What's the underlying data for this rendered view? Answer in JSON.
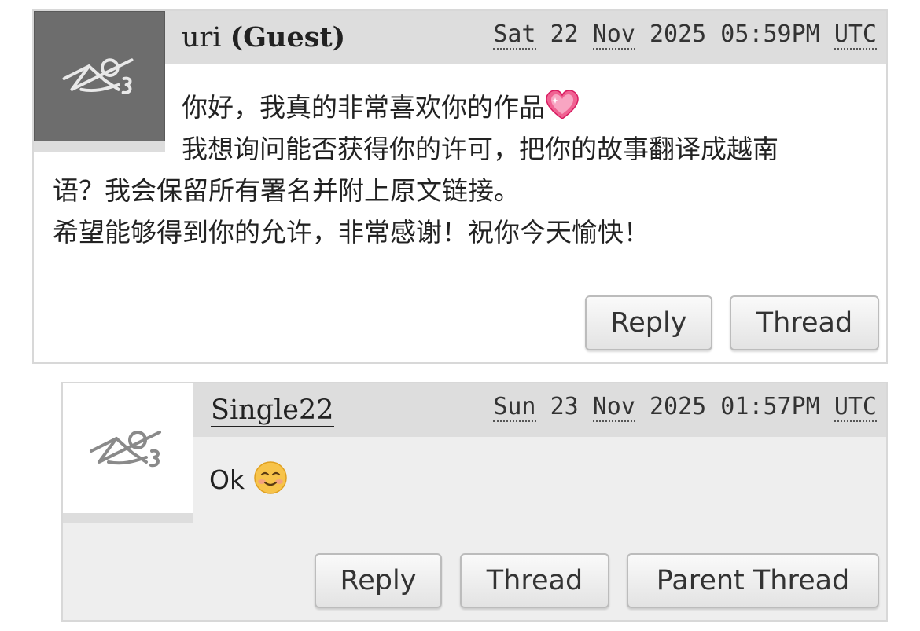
{
  "comments": [
    {
      "username": "uri",
      "guest_label": "(Guest)",
      "date": {
        "day": "Sat",
        "rest_date": "22",
        "month": "Nov",
        "year_time": "2025 05:59PM",
        "tz": "UTC"
      },
      "body_lines": [
        "你好，我真的非常喜欢你的作品",
        "我想询问能否获得你的许可，把你的故事翻译成越南",
        "语？我会保留所有署名并附上原文链接。",
        "希望能够得到你的允许，非常感谢！祝你今天愉快！"
      ],
      "emoji": "sparkling-heart",
      "buttons": [
        "Reply",
        "Thread"
      ]
    },
    {
      "username": "Single22",
      "date": {
        "day": "Sun",
        "rest_date": "23",
        "month": "Nov",
        "year_time": "2025 01:57PM",
        "tz": "UTC"
      },
      "body": "Ok",
      "emoji": "smiling-face",
      "buttons": [
        "Reply",
        "Thread",
        "Parent Thread"
      ]
    }
  ],
  "colors": {
    "header_bg": "#dddddd",
    "reply_bg": "#eeeeee",
    "avatar_dark": "#6d6d6d",
    "border": "#d8d8d8"
  }
}
